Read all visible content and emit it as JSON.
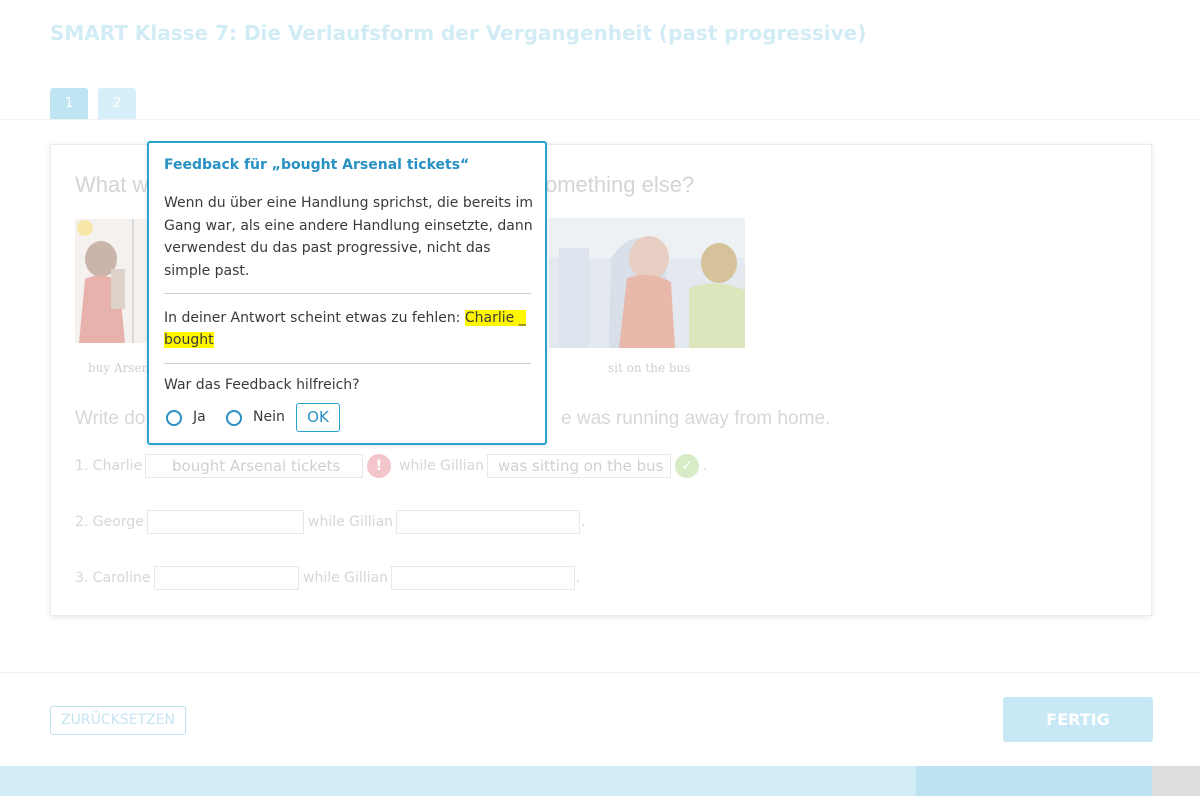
{
  "title": "SMART Klasse 7: Die Verlaufsform der Vergangenheit (past progressive)",
  "tabs": [
    {
      "label": "1"
    },
    {
      "label": "2"
    }
  ],
  "exercise": {
    "question_left": "What w",
    "question_right": "omething else?",
    "captions": [
      "buy Arsen",
      "sit on the bus"
    ],
    "instruction_left": "Write do",
    "instruction_right": "e was running away from home.",
    "rows": [
      {
        "label": "1. Charlie",
        "answer1": "bought Arsenal tickets",
        "while": "while Gillian",
        "answer2": "was sitting on the bus",
        "end": "."
      },
      {
        "label": "2. George",
        "answer1": "",
        "while": "while Gillian",
        "answer2": "",
        "end": "."
      },
      {
        "label": "3. Caroline",
        "answer1": "",
        "while": "while Gillian",
        "answer2": "",
        "end": "."
      }
    ]
  },
  "feedback": {
    "title": "Feedback für „bought Arsenal tickets“",
    "text": "Wenn du über eine Handlung sprichst, die bereits im Gang war, als eine andere Handlung einsetzte, dann verwendest du das past progressive, nicht das simple past.",
    "missing_prefix": "In deiner Antwort scheint etwas zu fehlen: ",
    "missing_highlight": "Charlie _ bought",
    "question": "War das Feedback hilfreich?",
    "option_yes": "Ja",
    "option_no": "Nein",
    "ok": "OK"
  },
  "buttons": {
    "reset": "ZURÜCKSETZEN",
    "done": "FERTIG"
  },
  "colors": {
    "accent": "#2aa2d0",
    "error": "#f4c5cb",
    "correct": "#d7ecc6",
    "highlight": "#fff700"
  }
}
